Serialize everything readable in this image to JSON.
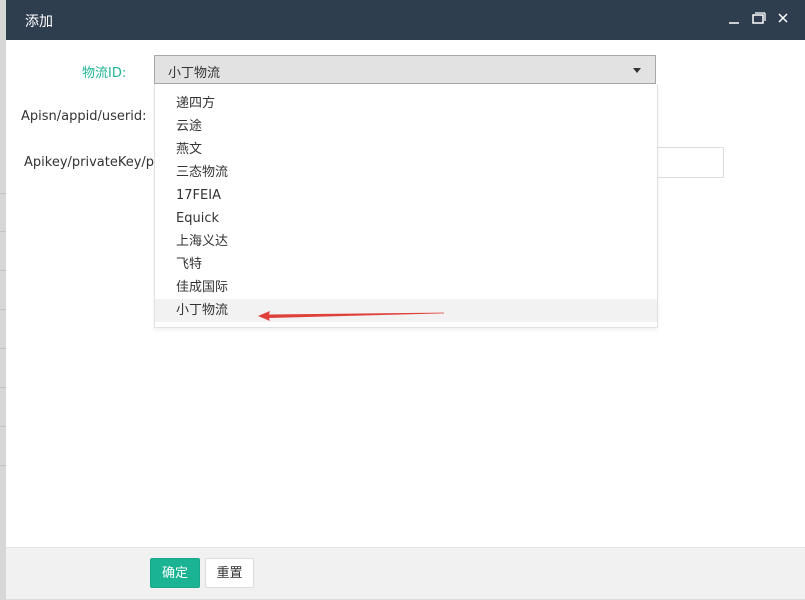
{
  "dialog": {
    "title": "添加"
  },
  "form": {
    "logistics_label": "物流ID:",
    "logistics_selected": "小丁物流",
    "apisn_label": "Apisn/appid/userid:",
    "apikey_label": "Apikey/privateKey/pass"
  },
  "dropdown": {
    "options": [
      "递四方",
      "云途",
      "燕文",
      "三态物流",
      "17FEIA",
      "Equick",
      "上海义达",
      "飞特",
      "佳成国际",
      "小丁物流"
    ],
    "selected_index": 9
  },
  "footer": {
    "confirm_label": "确定",
    "reset_label": "重置"
  },
  "colors": {
    "titlebar": "#2f3e4f",
    "accent": "#1ab394",
    "arrow": "#e0403a"
  }
}
